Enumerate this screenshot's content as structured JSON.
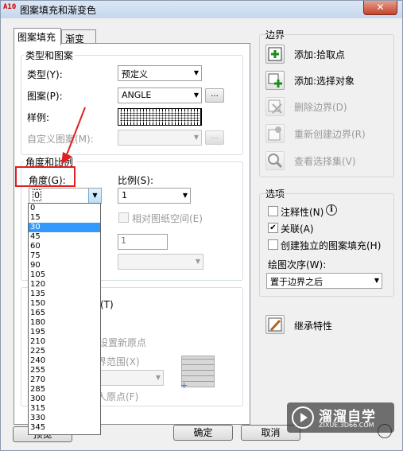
{
  "window": {
    "title": "图案填充和渐变色",
    "close_icon": "✕",
    "app_icon": "A10"
  },
  "tabs": [
    {
      "label": "图案填充"
    },
    {
      "label": "渐变色"
    }
  ],
  "type_pattern": {
    "group_label": "类型和图案",
    "type_label": "类型(Y):",
    "type_value": "预定义",
    "pattern_label": "图案(P):",
    "pattern_value": "ANGLE",
    "browse_label": "...",
    "swatch_label": "样例:",
    "custom_label": "自定义图案(M):"
  },
  "angle_scale": {
    "group_label": "角度和比例",
    "angle_label": "角度(G):",
    "angle_value": "0",
    "scale_label": "比例(S):",
    "scale_value": "1",
    "relative_label": "相对图纸空间(E)",
    "spacing_value": "1"
  },
  "angle_options": [
    "0",
    "15",
    "30",
    "45",
    "60",
    "75",
    "90",
    "105",
    "120",
    "135",
    "150",
    "165",
    "180",
    "195",
    "210",
    "225",
    "240",
    "255",
    "270",
    "285",
    "300",
    "315",
    "330",
    "345"
  ],
  "angle_selected": "30",
  "origin": {
    "fragment_t": "(T)",
    "set_new_origin": "设置新原点",
    "extent_label": "界范围(X)",
    "stored_origin": "人原点(F)"
  },
  "boundary": {
    "label": "边界",
    "add_pick": "添加:拾取点",
    "add_select": "添加:选择对象",
    "remove": "删除边界(D)",
    "recreate": "重新创建边界(R)",
    "view": "查看选择集(V)"
  },
  "options": {
    "label": "选项",
    "annotative": "注释性(N)",
    "associative": "关联(A)",
    "independent": "创建独立的图案填充(H)",
    "draw_order_label": "绘图次序(W):",
    "draw_order_value": "置于边界之后",
    "info_icon": "i"
  },
  "inherit": {
    "label": "继承特性"
  },
  "footer": {
    "preview": "预览",
    "ok": "确定",
    "cancel": "取消"
  },
  "watermark": {
    "title": "溜溜自学",
    "subtitle": "ZIXUE.3D66.COM"
  }
}
